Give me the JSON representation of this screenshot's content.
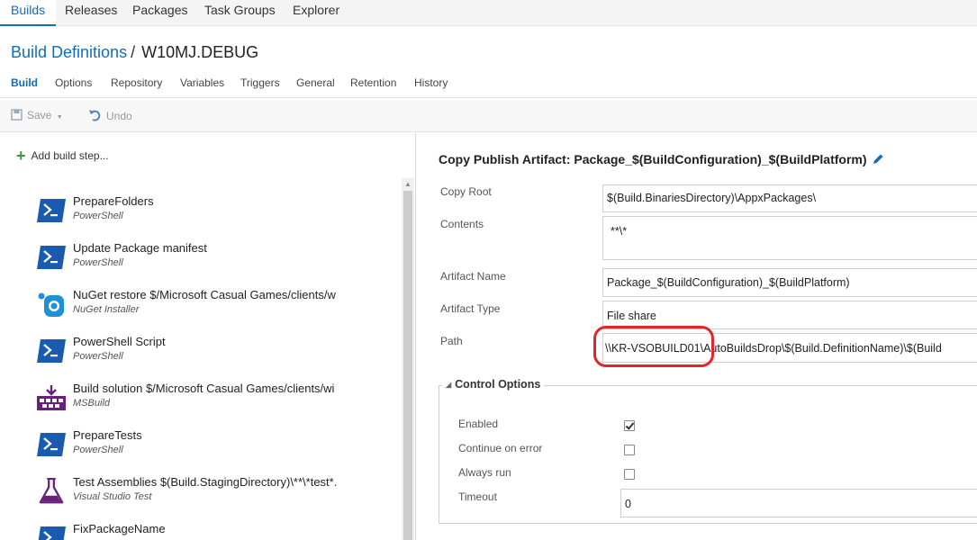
{
  "topnav": {
    "tabs": [
      "Builds",
      "Releases",
      "Packages",
      "Task Groups",
      "Explorer"
    ],
    "active": "Builds"
  },
  "breadcrumb": {
    "parent": "Build Definitions",
    "separator": "/",
    "current": "W10MJ.DEBUG"
  },
  "subtabs": [
    "Build",
    "Options",
    "Repository",
    "Variables",
    "Triggers",
    "General",
    "Retention",
    "History"
  ],
  "toolbar": {
    "save_label": "Save",
    "undo_label": "Undo"
  },
  "left": {
    "add_step_label": "Add build step...",
    "steps": [
      {
        "title": "PrepareFolders",
        "type": "PowerShell",
        "icon": "powershell-icon"
      },
      {
        "title": "Update Package manifest",
        "type": "PowerShell",
        "icon": "powershell-icon"
      },
      {
        "title": "NuGet restore $/Microsoft Casual Games/clients/w",
        "type": "NuGet Installer",
        "icon": "nuget-icon"
      },
      {
        "title": "PowerShell Script",
        "type": "PowerShell",
        "icon": "powershell-icon"
      },
      {
        "title": "Build solution $/Microsoft Casual Games/clients/wi",
        "type": "MSBuild",
        "icon": "msbuild-icon"
      },
      {
        "title": "PrepareTests",
        "type": "PowerShell",
        "icon": "powershell-icon"
      },
      {
        "title": "Test Assemblies $(Build.StagingDirectory)\\**\\*test*.",
        "type": "Visual Studio Test",
        "icon": "flask-icon"
      },
      {
        "title": "FixPackageName",
        "type": "",
        "icon": "powershell-icon"
      }
    ]
  },
  "task": {
    "title": "Copy Publish Artifact: Package_$(BuildConfiguration)_$(BuildPlatform)",
    "fields": {
      "copy_root_label": "Copy Root",
      "copy_root_value": "$(Build.BinariesDirectory)\\AppxPackages\\",
      "contents_label": "Contents",
      "contents_value": "**\\*",
      "artifact_name_label": "Artifact Name",
      "artifact_name_value": "Package_$(BuildConfiguration)_$(BuildPlatform)",
      "artifact_type_label": "Artifact Type",
      "artifact_type_value": "File share",
      "path_label": "Path",
      "path_value": "\\\\KR-VSOBUILD01\\AutoBuildsDrop\\$(Build.DefinitionName)\\$(Build"
    },
    "control_options": {
      "title": "Control Options",
      "enabled_label": "Enabled",
      "enabled": true,
      "continue_label": "Continue on error",
      "continue": false,
      "always_label": "Always run",
      "always": false,
      "timeout_label": "Timeout",
      "timeout_value": "0"
    }
  },
  "colors": {
    "accent": "#106ebe",
    "highlight_circle": "#e0262a",
    "powershell": "#1a5bb0",
    "msbuild": "#68217a",
    "nuget": "#1e90d6"
  }
}
